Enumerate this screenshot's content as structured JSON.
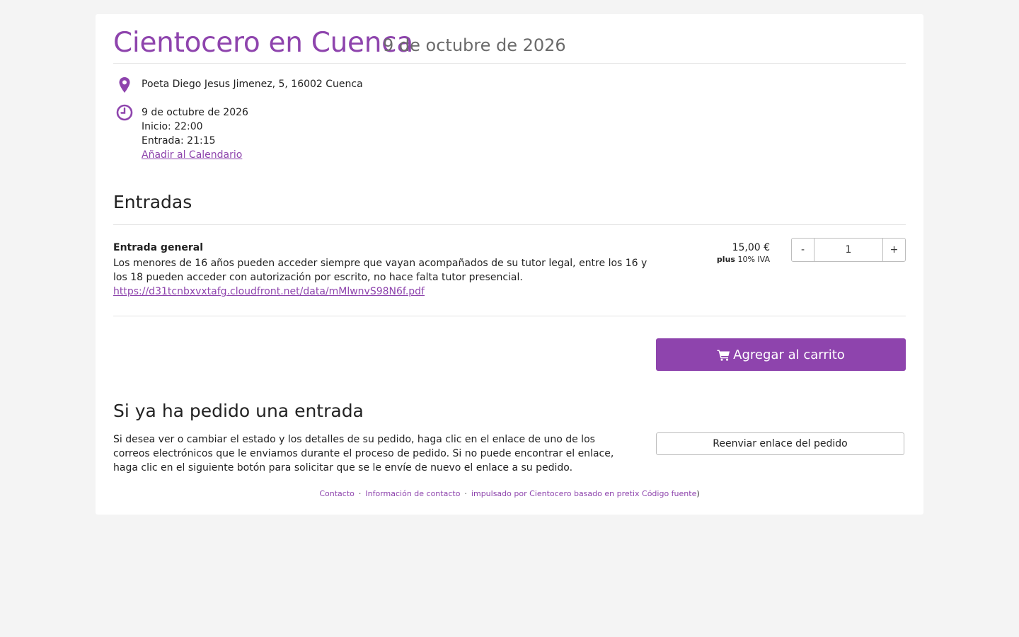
{
  "event": {
    "name": "Cientocero en Cuenca",
    "date": "9 de octubre de 2026"
  },
  "location": {
    "icon": "map-marker-icon",
    "address": "Poeta Diego Jesus Jimenez, 5, 16002 Cuenca"
  },
  "schedule": {
    "icon": "clock-icon",
    "date": "9 de octubre de 2026",
    "start": "Inicio: 22:00",
    "entry": "Entrada: 21:15",
    "calendar_link": "Añadir al Calendario"
  },
  "tickets": {
    "heading": "Entradas",
    "items": [
      {
        "name": "Entrada general",
        "description": "Los menores de 16 años pueden acceder siempre que vayan acompañados de su tutor legal, entre los 16 y los 18 pueden acceder con autorización por escrito, no hace falta tutor presencial.",
        "link": "https://d31tcnbxvxtafg.cloudfront.net/data/mMlwnvS98N6f.pdf",
        "price": "15,00 €",
        "tax_prefix": "plus",
        "tax": "10% IVA",
        "quantity": "1",
        "minus_label": "-",
        "plus_label": "+"
      }
    ]
  },
  "cart": {
    "icon": "shopping-cart-icon",
    "button_label": "Agregar al carrito"
  },
  "existing_order": {
    "heading": "Si ya ha pedido una entrada",
    "text": "Si desea ver o cambiar el estado y los detalles de su pedido, haga clic en el enlace de uno de los correos electrónicos que le enviamos durante el proceso de pedido. Si no puede encontrar el enlace, haga clic en el siguiente botón para solicitar que se le envíe de nuevo el enlace a su pedido.",
    "resend_label": "Reenviar enlace del pedido"
  },
  "footer": {
    "contact": "Contacto",
    "contact_info": "Información de contacto",
    "powered": "impulsado por Cientocero basado en pretix",
    "source": "Código fuente",
    "close_paren": ")",
    "separator": "·"
  },
  "colors": {
    "accent": "#8e44ad",
    "background": "#f4f4f4",
    "muted_text": "#6b6b6b"
  }
}
